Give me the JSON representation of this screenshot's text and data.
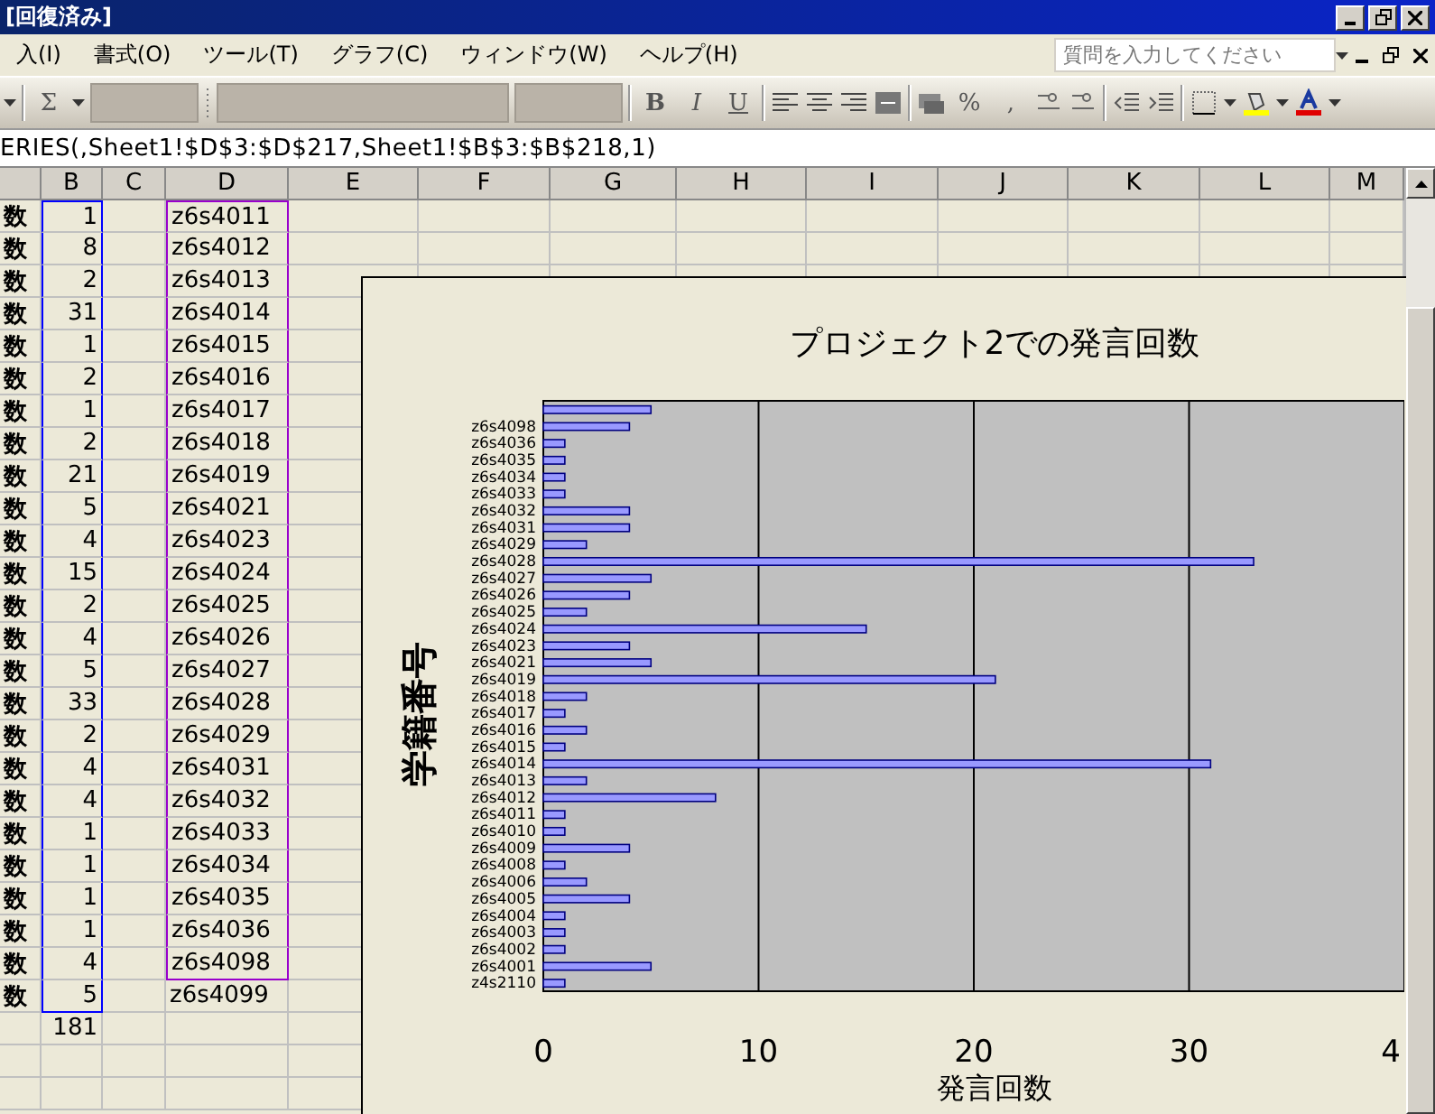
{
  "window": {
    "title": "[回復済み]"
  },
  "menu": [
    "入(I)",
    "書式(O)",
    "ツール(T)",
    "グラフ(C)",
    "ウィンドウ(W)",
    "ヘルプ(H)"
  ],
  "help_box": {
    "placeholder": "質問を入力してください"
  },
  "toolbar_labels": [
    "Σ",
    "B",
    "I",
    "U",
    "%",
    ","
  ],
  "formula": "ERIES(,Sheet1!$D$3:$D$217,Sheet1!$B$3:$B$218,1)",
  "columns": [
    "B",
    "C",
    "D",
    "E",
    "F",
    "G",
    "H",
    "I",
    "J",
    "K",
    "L",
    "M"
  ],
  "rows": [
    {
      "cells": [
        {
          "text": "数"
        },
        {
          "text": "1",
          "color": "#0000ff"
        },
        null,
        {
          "text": "z6s4011",
          "color": "#9900cc"
        }
      ]
    },
    {
      "cells": [
        {
          "text": "数"
        },
        {
          "text": "8",
          "color": "#0000ff"
        },
        null,
        {
          "text": "z6s4012",
          "color": "#9900cc"
        }
      ]
    },
    {
      "cells": [
        {
          "text": "数"
        },
        {
          "text": "2",
          "color": "#0000ff"
        },
        null,
        {
          "text": "z6s4013",
          "color": "#9900cc"
        }
      ]
    },
    {
      "cells": [
        {
          "text": "数"
        },
        {
          "text": "31",
          "color": "#0000ff"
        },
        null,
        {
          "text": "z6s4014",
          "color": "#9900cc"
        }
      ]
    },
    {
      "cells": [
        {
          "text": "数"
        },
        {
          "text": "1",
          "color": "#0000ff"
        },
        null,
        {
          "text": "z6s4015",
          "color": "#9900cc"
        }
      ]
    },
    {
      "cells": [
        {
          "text": "数"
        },
        {
          "text": "2",
          "color": "#0000ff"
        },
        null,
        {
          "text": "z6s4016",
          "color": "#9900cc"
        }
      ]
    },
    {
      "cells": [
        {
          "text": "数"
        },
        {
          "text": "1",
          "color": "#0000ff"
        },
        null,
        {
          "text": "z6s4017",
          "color": "#9900cc"
        }
      ]
    },
    {
      "cells": [
        {
          "text": "数"
        },
        {
          "text": "2",
          "color": "#0000ff"
        },
        null,
        {
          "text": "z6s4018",
          "color": "#9900cc"
        }
      ]
    },
    {
      "cells": [
        {
          "text": "数"
        },
        {
          "text": "21",
          "color": "#0000ff"
        },
        null,
        {
          "text": "z6s4019",
          "color": "#9900cc"
        }
      ]
    },
    {
      "cells": [
        {
          "text": "数"
        },
        {
          "text": "5",
          "color": "#0000ff"
        },
        null,
        {
          "text": "z6s4021",
          "color": "#9900cc"
        }
      ]
    },
    {
      "cells": [
        {
          "text": "数"
        },
        {
          "text": "4",
          "color": "#0000ff"
        },
        null,
        {
          "text": "z6s4023",
          "color": "#9900cc"
        }
      ]
    },
    {
      "cells": [
        {
          "text": "数"
        },
        {
          "text": "15",
          "color": "#0000ff"
        },
        null,
        {
          "text": "z6s4024",
          "color": "#9900cc"
        }
      ]
    },
    {
      "cells": [
        {
          "text": "数"
        },
        {
          "text": "2",
          "color": "#0000ff"
        },
        null,
        {
          "text": "z6s4025",
          "color": "#9900cc"
        }
      ]
    },
    {
      "cells": [
        {
          "text": "数"
        },
        {
          "text": "4",
          "color": "#0000ff"
        },
        null,
        {
          "text": "z6s4026",
          "color": "#9900cc"
        }
      ]
    },
    {
      "cells": [
        {
          "text": "数"
        },
        {
          "text": "5",
          "color": "#0000ff"
        },
        null,
        {
          "text": "z6s4027",
          "color": "#9900cc"
        }
      ]
    },
    {
      "cells": [
        {
          "text": "数"
        },
        {
          "text": "33",
          "color": "#0000ff"
        },
        null,
        {
          "text": "z6s4028",
          "color": "#9900cc"
        }
      ]
    },
    {
      "cells": [
        {
          "text": "数"
        },
        {
          "text": "2",
          "color": "#0000ff"
        },
        null,
        {
          "text": "z6s4029",
          "color": "#9900cc"
        }
      ]
    },
    {
      "cells": [
        {
          "text": "数"
        },
        {
          "text": "4",
          "color": "#0000ff"
        },
        null,
        {
          "text": "z6s4031",
          "color": "#9900cc"
        }
      ]
    },
    {
      "cells": [
        {
          "text": "数"
        },
        {
          "text": "4",
          "color": "#0000ff"
        },
        null,
        {
          "text": "z6s4032",
          "color": "#9900cc"
        }
      ]
    },
    {
      "cells": [
        {
          "text": "数"
        },
        {
          "text": "1",
          "color": "#0000ff"
        },
        null,
        {
          "text": "z6s4033",
          "color": "#9900cc"
        }
      ]
    },
    {
      "cells": [
        {
          "text": "数"
        },
        {
          "text": "1",
          "color": "#0000ff"
        },
        null,
        {
          "text": "z6s4034",
          "color": "#9900cc"
        }
      ]
    },
    {
      "cells": [
        {
          "text": "数"
        },
        {
          "text": "1",
          "color": "#0000ff"
        },
        null,
        {
          "text": "z6s4035",
          "color": "#9900cc"
        }
      ]
    },
    {
      "cells": [
        {
          "text": "数"
        },
        {
          "text": "1",
          "color": "#0000ff"
        },
        null,
        {
          "text": "z6s4036",
          "color": "#9900cc"
        }
      ]
    },
    {
      "cells": [
        {
          "text": "数"
        },
        {
          "text": "4",
          "color": "#0000ff"
        },
        null,
        {
          "text": "z6s4098",
          "color": "#9900cc"
        }
      ]
    },
    {
      "cells": [
        {
          "text": "数"
        },
        {
          "text": "5",
          "color": "#0000ff"
        },
        null,
        {
          "text": "z6s4099"
        }
      ]
    },
    {
      "cells": [
        null,
        {
          "text": "181"
        }
      ]
    }
  ],
  "chart": {
    "chart_data": {
      "type": "bar",
      "orientation": "horizontal",
      "title": "プロジェクト2での発言回数",
      "xlabel": "発言回数",
      "ylabel": "学籍番号",
      "grid": true,
      "categories": [
        null,
        "z6s4098",
        "z6s4036",
        "z6s4035",
        "z6s4034",
        "z6s4033",
        "z6s4032",
        "z6s4031",
        "z6s4029",
        "z6s4028",
        "z6s4027",
        "z6s4026",
        "z6s4025",
        "z6s4024",
        "z6s4023",
        "z6s4021",
        "z6s4019",
        "z6s4018",
        "z6s4017",
        "z6s4016",
        "z6s4015",
        "z6s4014",
        "z6s4013",
        "z6s4012",
        "z6s4011",
        "z6s4010",
        "z6s4009",
        "z6s4008",
        "z6s4006",
        "z6s4005",
        "z6s4004",
        "z6s4003",
        "z6s4002",
        "z6s4001",
        "z4s2110"
      ],
      "values": [
        5,
        4,
        1,
        1,
        1,
        1,
        4,
        4,
        2,
        33,
        5,
        4,
        2,
        15,
        4,
        5,
        21,
        2,
        1,
        2,
        1,
        31,
        2,
        8,
        1,
        1,
        4,
        1,
        2,
        4,
        1,
        1,
        1,
        5,
        1
      ],
      "xlim": [
        0,
        40
      ],
      "xticks": [
        0,
        10,
        20,
        30
      ]
    },
    "cut_tick_label": "4"
  }
}
